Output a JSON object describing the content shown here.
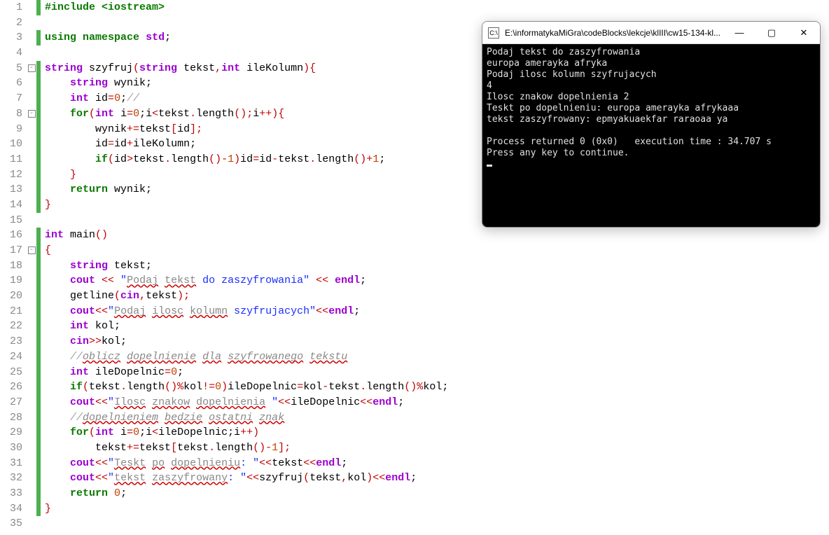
{
  "lineCount": 35,
  "changed": [
    1,
    3,
    5,
    6,
    7,
    8,
    9,
    10,
    11,
    12,
    13,
    14,
    16,
    17,
    18,
    19,
    20,
    21,
    22,
    23,
    24,
    25,
    26,
    27,
    28,
    29,
    30,
    31,
    32,
    33,
    34
  ],
  "foldOpen": [
    5,
    8,
    17
  ],
  "code": {
    "l1": {
      "a": "#include ",
      "b": "<iostream>"
    },
    "l3": {
      "a": "using",
      "b": "namespace",
      "c": "std",
      "d": ";"
    },
    "l5": {
      "a": "string",
      "b": " szyfruj",
      "c": "(",
      "d": "string",
      "e": " tekst",
      "f": ",",
      "g": "int",
      "h": " ileKolumn",
      "i": ")",
      "j": "{"
    },
    "l6": {
      "a": "string",
      "b": " wynik",
      "c": ";"
    },
    "l7": {
      "a": "int",
      "b": " id",
      "c": "=",
      "d": "0",
      "e": ";",
      "f": "//"
    },
    "l8": {
      "a": "for",
      "b": "(",
      "c": "int",
      "d": " i",
      "e": "=",
      "f": "0",
      "g": ";",
      "h": "i",
      "i": "<",
      "j": "tekst",
      "k": ".",
      "l": "length",
      "m": "();",
      "n": "i",
      "o": "++)",
      "p": "{"
    },
    "l9": {
      "a": "wynik",
      "b": "+=",
      "c": "tekst",
      "d": "[",
      "e": "id",
      "f": "];"
    },
    "l10": {
      "a": "id",
      "b": "=",
      "c": "id",
      "d": "+",
      "e": "ileKolumn",
      "f": ";"
    },
    "l11": {
      "a": "if",
      "b": "(",
      "c": "id",
      "d": ">",
      "e": "tekst",
      "f": ".",
      "g": "length",
      "h": "()-",
      "i": "1",
      "j": ")",
      "k": "id",
      "l": "=",
      "m": "id",
      "n": "-",
      "o": "tekst",
      "p": ".",
      "q": "length",
      "r": "()+",
      "s": "1",
      "t": ";"
    },
    "l12": {
      "a": "}"
    },
    "l13": {
      "a": "return",
      "b": " wynik",
      "c": ";"
    },
    "l14": {
      "a": "}"
    },
    "l16": {
      "a": "int",
      "b": " main",
      "c": "()"
    },
    "l17": {
      "a": "{"
    },
    "l18": {
      "a": "string",
      "b": " tekst",
      "c": ";"
    },
    "l19": {
      "a": "cout",
      "b": " << ",
      "c": "\"",
      "d": "Podaj",
      "e": " ",
      "f": "tekst",
      "g": " do zaszyfrowania\"",
      "h": " << ",
      "i": "endl",
      "j": ";"
    },
    "l20": {
      "a": "getline",
      "b": "(",
      "c": "cin",
      "d": ",",
      "e": "tekst",
      "f": ");"
    },
    "l21": {
      "a": "cout",
      "b": "<<",
      "c": "\"",
      "d": "Podaj",
      "e": " ",
      "f": "ilosc",
      "g": " ",
      "h": "kolumn",
      "i": " szyfrujacych\"",
      "j": "<<",
      "k": "endl",
      "l": ";"
    },
    "l22": {
      "a": "int",
      "b": " kol",
      "c": ";"
    },
    "l23": {
      "a": "cin",
      "b": ">>",
      "c": "kol",
      "d": ";"
    },
    "l24": {
      "a": "//",
      "b": "oblicz",
      "c": " ",
      "d": "dopelnienie",
      "e": " ",
      "f": "dla",
      "g": " ",
      "h": "szyfrowanego",
      "i": " ",
      "j": "tekstu"
    },
    "l25": {
      "a": "int",
      "b": " ileDopelnic",
      "c": "=",
      "d": "0",
      "e": ";"
    },
    "l26": {
      "a": "if",
      "b": "(",
      "c": "tekst",
      "d": ".",
      "e": "length",
      "f": "()%",
      "g": "kol",
      "h": "!=",
      "i": "0",
      "j": ")",
      "k": "ileDopelnic",
      "l": "=",
      "m": "kol",
      "n": "-",
      "o": "tekst",
      "p": ".",
      "q": "length",
      "r": "()%",
      "s": "kol",
      "t": ";"
    },
    "l27": {
      "a": "cout",
      "b": "<<",
      "c": "\"",
      "d": "Ilosc",
      "e": " ",
      "f": "znakow",
      "g": " ",
      "h": "dopelnienia",
      "i": " \"",
      "j": "<<",
      "k": "ileDopelnic",
      "l": "<<",
      "m": "endl",
      "n": ";"
    },
    "l28": {
      "a": "//",
      "b": "dopelnieniem",
      "c": " ",
      "d": "bedzie",
      "e": " ",
      "f": "ostatni",
      "g": " ",
      "h": "znak"
    },
    "l29": {
      "a": "for",
      "b": "(",
      "c": "int",
      "d": " i",
      "e": "=",
      "f": "0",
      "g": ";",
      "h": "i",
      "i": "<",
      "j": "ileDopelnic",
      "k": ";",
      "l": "i",
      "m": "++)"
    },
    "l30": {
      "a": "tekst",
      "b": "+=",
      "c": "tekst",
      "d": "[",
      "e": "tekst",
      "f": ".",
      "g": "length",
      "h": "()-",
      "i": "1",
      "j": "];"
    },
    "l31": {
      "a": "cout",
      "b": "<<",
      "c": "\"",
      "d": "Teskt",
      "e": " ",
      "f": "po",
      "g": " ",
      "h": "dopelnieniu",
      "i": ": \"",
      "j": "<<",
      "k": "tekst",
      "l": "<<",
      "m": "endl",
      "n": ";"
    },
    "l32": {
      "a": "cout",
      "b": "<<",
      "c": "\"",
      "d": "tekst",
      "e": " ",
      "f": "zaszyfrowany",
      "g": ": \"",
      "h": "<<",
      "i": "szyfruj",
      "j": "(",
      "k": "tekst",
      "l": ",",
      "m": "kol",
      "n": ")<<",
      "o": "endl",
      "p": ";"
    },
    "l33": {
      "a": "return",
      "b": " ",
      "c": "0",
      "d": ";"
    },
    "l34": {
      "a": "}"
    }
  },
  "console": {
    "title": "E:\\informatykaMiGra\\codeBlocks\\lekcje\\klIII\\cw15-134-kl...",
    "lines": [
      "Podaj tekst do zaszyfrowania",
      "europa amerayka afryka",
      "Podaj ilosc kolumn szyfrujacych",
      "4",
      "Ilosc znakow dopelnienia 2",
      "Teskt po dopelnieniu: europa amerayka afrykaaa",
      "tekst zaszyfrowany: epmyakuaekfar raraoaa ya",
      "",
      "Process returned 0 (0x0)   execution time : 34.707 s",
      "Press any key to continue."
    ]
  }
}
